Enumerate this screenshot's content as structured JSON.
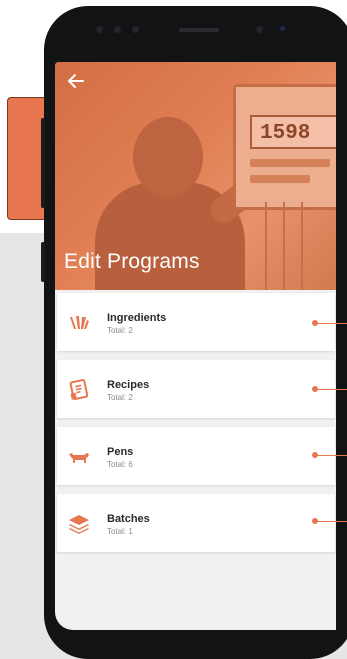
{
  "colors": {
    "accent": "#e8774f",
    "phone": "#121315"
  },
  "header": {
    "title": "Edit Programs",
    "back_icon": "arrow-left-icon",
    "display_value": "1598"
  },
  "programs": [
    {
      "label": "Ingredients",
      "total": "Total: 2",
      "icon": "wheat-icon"
    },
    {
      "label": "Recipes",
      "total": "Total: 2",
      "icon": "recipe-list-icon"
    },
    {
      "label": "Pens",
      "total": "Total: 6",
      "icon": "cow-icon"
    },
    {
      "label": "Batches",
      "total": "Total: 1",
      "icon": "layers-icon"
    }
  ]
}
